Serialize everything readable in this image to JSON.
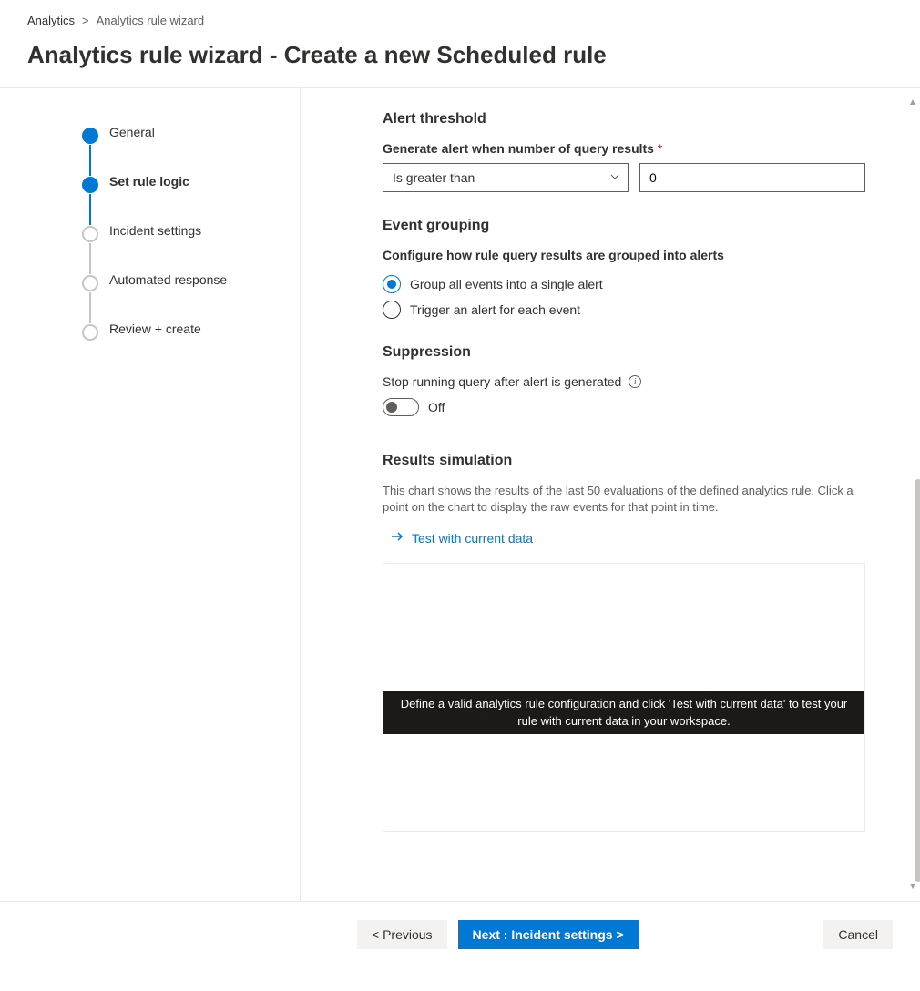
{
  "breadcrumb": {
    "root": "Analytics",
    "current": "Analytics rule wizard"
  },
  "page_title": "Analytics rule wizard - Create a new Scheduled rule",
  "steps": [
    {
      "label": "General"
    },
    {
      "label": "Set rule logic"
    },
    {
      "label": "Incident settings"
    },
    {
      "label": "Automated response"
    },
    {
      "label": "Review + create"
    }
  ],
  "alert_threshold": {
    "heading": "Alert threshold",
    "label": "Generate alert when number of query results",
    "operator": "Is greater than",
    "value": "0"
  },
  "event_grouping": {
    "heading": "Event grouping",
    "label": "Configure how rule query results are grouped into alerts",
    "option_group_all": "Group all events into a single alert",
    "option_each": "Trigger an alert for each event"
  },
  "suppression": {
    "heading": "Suppression",
    "label": "Stop running query after alert is generated",
    "state": "Off"
  },
  "results_sim": {
    "heading": "Results simulation",
    "desc": "This chart shows the results of the last 50 evaluations of the defined analytics rule. Click a point on the chart to display the raw events for that point in time.",
    "test_link": "Test with current data",
    "banner": "Define a valid analytics rule configuration and click 'Test with current data' to test your rule with current data in your workspace."
  },
  "footer": {
    "previous": "< Previous",
    "next": "Next : Incident settings >",
    "cancel": "Cancel"
  }
}
